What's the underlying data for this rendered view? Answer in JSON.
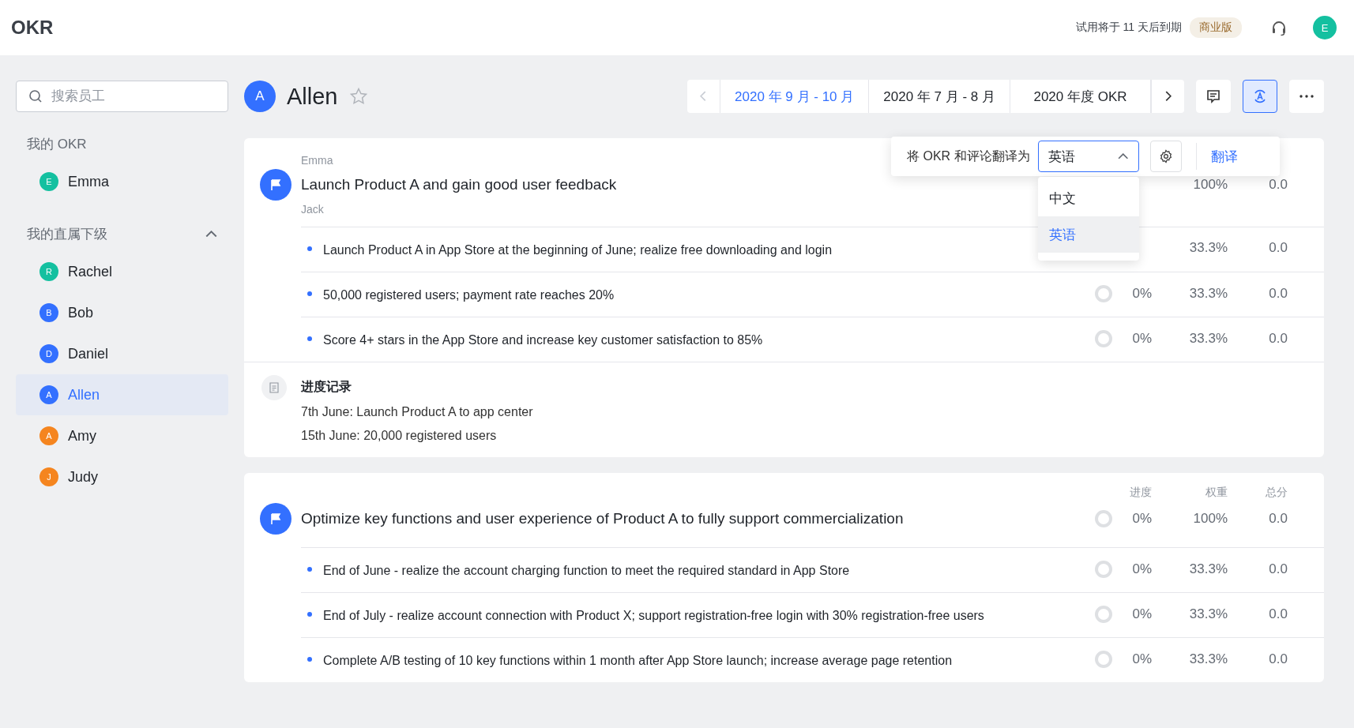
{
  "app_title": "OKR",
  "topbar": {
    "trial_notice": "试用将于 11 天后到期",
    "plan_badge": "商业版",
    "user": {
      "initial": "E",
      "color": "#14c0a0"
    }
  },
  "sidebar": {
    "search": {
      "placeholder": "搜索员工"
    },
    "sections": [
      {
        "title": "我的 OKR",
        "kind": "plain",
        "items": [
          {
            "initial": "E",
            "name": "Emma",
            "color": "#14c0a0",
            "selected": false
          }
        ]
      },
      {
        "title": "我的直属下级",
        "kind": "collapsible",
        "expanded": true,
        "items": [
          {
            "initial": "R",
            "name": "Rachel",
            "color": "#14c0a0",
            "selected": false
          },
          {
            "initial": "B",
            "name": "Bob",
            "color": "#3370ff",
            "selected": false
          },
          {
            "initial": "D",
            "name": "Daniel",
            "color": "#3370ff",
            "selected": false
          },
          {
            "initial": "A",
            "name": "Allen",
            "color": "#3370ff",
            "selected": true
          },
          {
            "initial": "A",
            "name": "Amy",
            "color": "#f5851f",
            "selected": false
          },
          {
            "initial": "J",
            "name": "Judy",
            "color": "#f5851f",
            "selected": false
          }
        ]
      }
    ]
  },
  "person": {
    "initial": "A",
    "name": "Allen",
    "starred": false
  },
  "periods": {
    "prev_disabled": true,
    "items": [
      {
        "label": "2020 年 9 月 - 10 月",
        "selected": true
      },
      {
        "label": "2020 年 7 月 - 8 月",
        "selected": false
      },
      {
        "label": "2020 年度 OKR",
        "selected": false
      }
    ],
    "next_disabled": false
  },
  "toolbar": [
    {
      "kind": "comment",
      "selected": false
    },
    {
      "kind": "translate",
      "selected": true
    },
    {
      "kind": "more",
      "selected": false
    }
  ],
  "translate_popup": {
    "label": "将 OKR 和评论翻译为",
    "select": {
      "value": "英语",
      "expanded": true
    },
    "action": "翻译",
    "options": [
      {
        "label": "中文",
        "selected": false
      },
      {
        "label": "英语",
        "selected": true
      }
    ]
  },
  "objectives": [
    {
      "aligned_from": "Emma",
      "aligned_to": "Jack",
      "title": "Launch Product A and gain good user feedback",
      "weight": "100%",
      "score": "0.0",
      "key_results": [
        {
          "text": "Launch Product A in App Store at the beginning of June; realize free downloading and login",
          "weight": "33.3%",
          "score": "0.0"
        },
        {
          "text": "50,000 registered users; payment rate reaches 20%",
          "progress": "0%",
          "weight": "33.3%",
          "score": "0.0"
        },
        {
          "text": "Score 4+ stars in the App Store and increase key customer satisfaction to 85%",
          "progress": "0%",
          "weight": "33.3%",
          "score": "0.0"
        }
      ],
      "progress_log": {
        "title": "进度记录",
        "entries": [
          "7th June: Launch Product A to app center",
          "15th June: 20,000 registered users"
        ]
      }
    },
    {
      "columns": [
        "进度",
        "权重",
        "总分"
      ],
      "title": "Optimize key functions and user experience of Product A to fully support commercialization",
      "progress": "0%",
      "weight": "100%",
      "score": "0.0",
      "key_results": [
        {
          "text": "End of June - realize the account charging function to meet the required standard in App Store",
          "progress": "0%",
          "weight": "33.3%",
          "score": "0.0"
        },
        {
          "text": "End of July - realize account connection with Product X; support registration-free login with 30% registration-free users",
          "progress": "0%",
          "weight": "33.3%",
          "score": "0.0"
        },
        {
          "text": "Complete A/B testing of 10 key functions within 1 month after App Store launch; increase average page retention",
          "progress": "0%",
          "weight": "33.3%",
          "score": "0.0"
        }
      ]
    }
  ]
}
